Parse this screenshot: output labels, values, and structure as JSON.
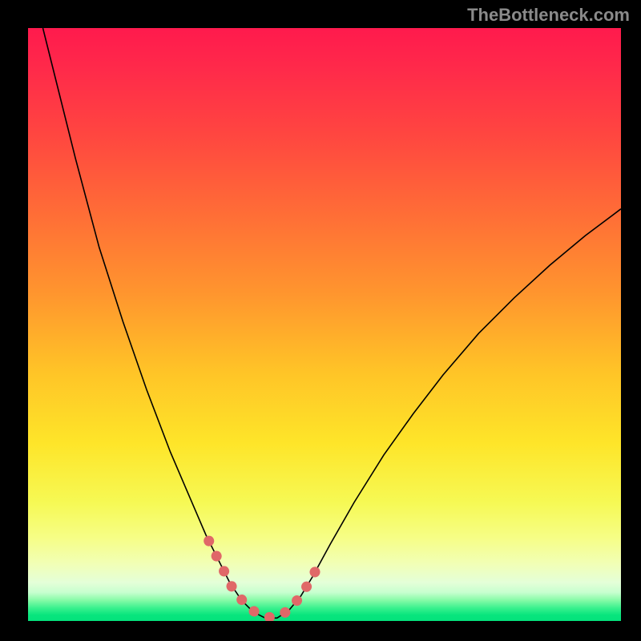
{
  "attribution": "TheBottleneck.com",
  "gradient_stops": [
    {
      "offset": 0.0,
      "color": "#ff1a4d"
    },
    {
      "offset": 0.07,
      "color": "#ff2a4a"
    },
    {
      "offset": 0.18,
      "color": "#ff4640"
    },
    {
      "offset": 0.32,
      "color": "#ff6f36"
    },
    {
      "offset": 0.45,
      "color": "#ff962e"
    },
    {
      "offset": 0.58,
      "color": "#ffc427"
    },
    {
      "offset": 0.7,
      "color": "#fee529"
    },
    {
      "offset": 0.8,
      "color": "#f6f954"
    },
    {
      "offset": 0.86,
      "color": "#f6fe86"
    },
    {
      "offset": 0.905,
      "color": "#f1ffb7"
    },
    {
      "offset": 0.935,
      "color": "#e4ffd8"
    },
    {
      "offset": 0.952,
      "color": "#c7ffcf"
    },
    {
      "offset": 0.965,
      "color": "#86fba7"
    },
    {
      "offset": 0.978,
      "color": "#3af18e"
    },
    {
      "offset": 0.99,
      "color": "#08e57d"
    },
    {
      "offset": 1.0,
      "color": "#04e27c"
    }
  ],
  "chart_data": {
    "type": "line",
    "title": "",
    "xlabel": "",
    "ylabel": "",
    "xlim": [
      0,
      100
    ],
    "ylim": [
      0,
      100
    ],
    "series": [
      {
        "name": "bottleneck-curve",
        "stroke": "#000000",
        "stroke_width": 1.6,
        "points": [
          {
            "x": 2.5,
            "y": 100.0
          },
          {
            "x": 5.0,
            "y": 90.0
          },
          {
            "x": 8.0,
            "y": 78.0
          },
          {
            "x": 12.0,
            "y": 63.0
          },
          {
            "x": 16.0,
            "y": 50.5
          },
          {
            "x": 20.0,
            "y": 39.0
          },
          {
            "x": 24.0,
            "y": 28.5
          },
          {
            "x": 27.0,
            "y": 21.5
          },
          {
            "x": 30.0,
            "y": 14.5
          },
          {
            "x": 32.0,
            "y": 10.5
          },
          {
            "x": 34.0,
            "y": 6.5
          },
          {
            "x": 36.0,
            "y": 3.5
          },
          {
            "x": 38.0,
            "y": 1.5
          },
          {
            "x": 40.0,
            "y": 0.5
          },
          {
            "x": 42.0,
            "y": 0.5
          },
          {
            "x": 44.0,
            "y": 1.8
          },
          {
            "x": 46.0,
            "y": 4.2
          },
          {
            "x": 48.0,
            "y": 7.5
          },
          {
            "x": 51.0,
            "y": 13.0
          },
          {
            "x": 55.0,
            "y": 20.0
          },
          {
            "x": 60.0,
            "y": 28.0
          },
          {
            "x": 65.0,
            "y": 35.0
          },
          {
            "x": 70.0,
            "y": 41.5
          },
          {
            "x": 76.0,
            "y": 48.5
          },
          {
            "x": 82.0,
            "y": 54.5
          },
          {
            "x": 88.0,
            "y": 60.0
          },
          {
            "x": 94.0,
            "y": 65.0
          },
          {
            "x": 100.0,
            "y": 69.5
          }
        ]
      },
      {
        "name": "highlight-segment",
        "stroke": "#e06868",
        "stroke_width": 13,
        "stroke_linecap": "round",
        "stroke_dasharray": "0.1 21",
        "points": [
          {
            "x": 30.5,
            "y": 13.5
          },
          {
            "x": 32.5,
            "y": 9.5
          },
          {
            "x": 34.5,
            "y": 5.5
          },
          {
            "x": 36.5,
            "y": 3.0
          },
          {
            "x": 38.5,
            "y": 1.3
          },
          {
            "x": 40.5,
            "y": 0.6
          },
          {
            "x": 42.5,
            "y": 0.8
          },
          {
            "x": 44.5,
            "y": 2.3
          },
          {
            "x": 46.5,
            "y": 5.0
          },
          {
            "x": 48.0,
            "y": 7.5
          },
          {
            "x": 49.5,
            "y": 10.5
          }
        ]
      }
    ]
  }
}
